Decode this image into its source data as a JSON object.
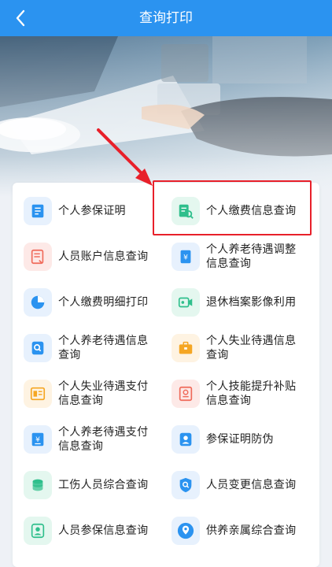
{
  "nav": {
    "title": "查询打印",
    "back_icon": "chevron-left-icon"
  },
  "colors": {
    "primary": "#2b93f0",
    "highlight": "#e8202a"
  },
  "menu": [
    {
      "label": "个人参保证明",
      "icon": "certificate-icon",
      "color": "#2b93f0",
      "bg": "#e7f1fd"
    },
    {
      "label": "个人缴费信息查询",
      "icon": "payment-search-icon",
      "color": "#2fbf8c",
      "bg": "#e4f7ef"
    },
    {
      "label": "人员账户信息查询",
      "icon": "account-document-icon",
      "color": "#f06a5a",
      "bg": "#fde9e7"
    },
    {
      "label": "个人养老待遇调整信息查询",
      "icon": "pension-adjust-icon",
      "color": "#2b93f0",
      "bg": "#e7f1fd"
    },
    {
      "label": "个人缴费明细打印",
      "icon": "pie-chart-icon",
      "color": "#2b93f0",
      "bg": "#e7f1fd"
    },
    {
      "label": "退休档案影像利用",
      "icon": "video-camera-icon",
      "color": "#2fbf8c",
      "bg": "#e4f7ef"
    },
    {
      "label": "个人养老待遇信息查询",
      "icon": "search-doc-icon",
      "color": "#2b93f0",
      "bg": "#e7f1fd"
    },
    {
      "label": "个人失业待遇信息查询",
      "icon": "briefcase-icon",
      "color": "#f5a623",
      "bg": "#fef3e2"
    },
    {
      "label": "个人失业待遇支付信息查询",
      "icon": "payment-record-icon",
      "color": "#f5a623",
      "bg": "#fef3e2"
    },
    {
      "label": "个人技能提升补贴信息查询",
      "icon": "skill-subsidy-icon",
      "color": "#f06a5a",
      "bg": "#fde9e7"
    },
    {
      "label": "个人养老待遇支付信息查询",
      "icon": "yuan-payment-icon",
      "color": "#2b93f0",
      "bg": "#e7f1fd"
    },
    {
      "label": "参保证明防伪",
      "icon": "anti-fake-icon",
      "color": "#2b93f0",
      "bg": "#e7f1fd"
    },
    {
      "label": "工伤人员综合查询",
      "icon": "coins-icon",
      "color": "#2fbf8c",
      "bg": "#e4f7ef"
    },
    {
      "label": "人员变更信息查询",
      "icon": "shield-search-icon",
      "color": "#2b93f0",
      "bg": "#e7f1fd"
    },
    {
      "label": "人员参保信息查询",
      "icon": "user-badge-icon",
      "color": "#2fbf8c",
      "bg": "#e4f7ef"
    },
    {
      "label": "供养亲属综合查询",
      "icon": "location-pin-icon",
      "color": "#2b93f0",
      "bg": "#e7f1fd"
    }
  ]
}
